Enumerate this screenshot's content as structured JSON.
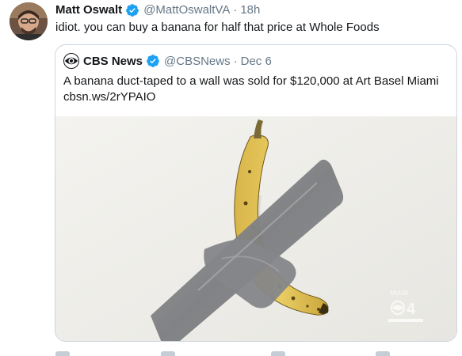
{
  "tweet": {
    "author_name": "Matt Oswalt",
    "author_handle": "@MattOswaltVA",
    "separator": "·",
    "time": "18h",
    "text": "idiot. you can buy a banana for half that price at Whole Foods",
    "verified_icon": "verified-badge-icon",
    "avatar": "user-avatar"
  },
  "quoted": {
    "author_name": "CBS News",
    "author_handle": "@CBSNews",
    "separator": "·",
    "date": "Dec 6",
    "text_line1": "A banana duct-taped to a wall was sold for $120,000 at Art Basel Miami",
    "text_line2": "cbsn.ws/2rYPAIO",
    "logo_icon": "cbs-eye-icon",
    "verified_icon": "verified-badge-icon",
    "media": {
      "description_icon": "banana-photo",
      "watermark_city": "MIAMI",
      "watermark_channel": "4"
    }
  },
  "colors": {
    "verified_blue": "#1da1f2",
    "text_primary": "#14171a",
    "text_secondary": "#657786",
    "border": "#ccd6dd"
  }
}
